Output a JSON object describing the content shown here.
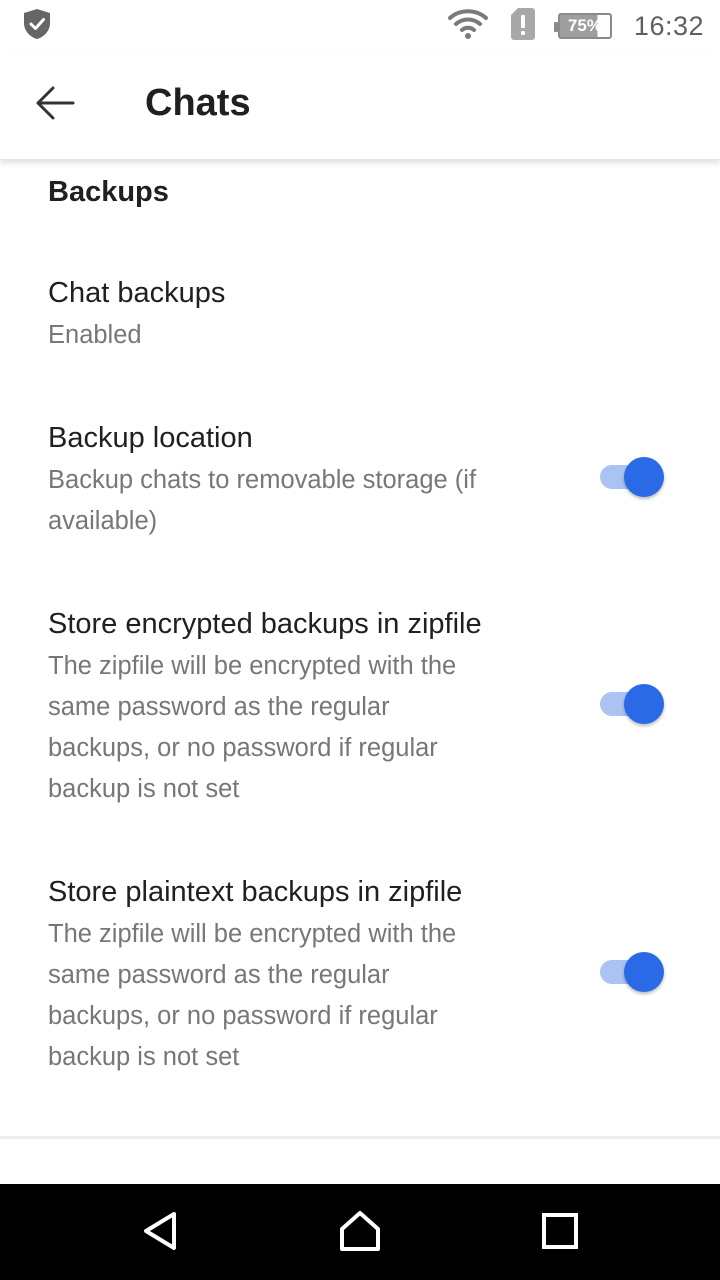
{
  "status_bar": {
    "time": "16:32",
    "battery_level": "75%",
    "icons": [
      "shield-icon",
      "wifi-icon",
      "sim-alert-icon",
      "battery-icon"
    ]
  },
  "app_bar": {
    "title": "Chats",
    "back_icon": "arrow-back-icon"
  },
  "section": {
    "header": "Backups"
  },
  "preferences": [
    {
      "title": "Chat backups",
      "summary": "Enabled"
    },
    {
      "title": "Backup location",
      "summary": "Backup chats to removable storage (if available)",
      "switch_on": true
    },
    {
      "title": "Store encrypted backups in zipfile",
      "summary": "The zipfile will be encrypted with the same password as the regular backups, or no password if regular backup is not set",
      "switch_on": true
    },
    {
      "title": "Store plaintext backups in zipfile",
      "summary": "The zipfile will be encrypted with the same password as the regular backups, or no password if regular backup is not set",
      "switch_on": true
    }
  ],
  "nav_bar": {
    "icons": [
      "nav-back-icon",
      "nav-home-icon",
      "nav-recents-icon"
    ]
  },
  "colors": {
    "accent": "#2a6ae6",
    "switch_track": "#aac3f3",
    "summary_text": "#777777"
  }
}
